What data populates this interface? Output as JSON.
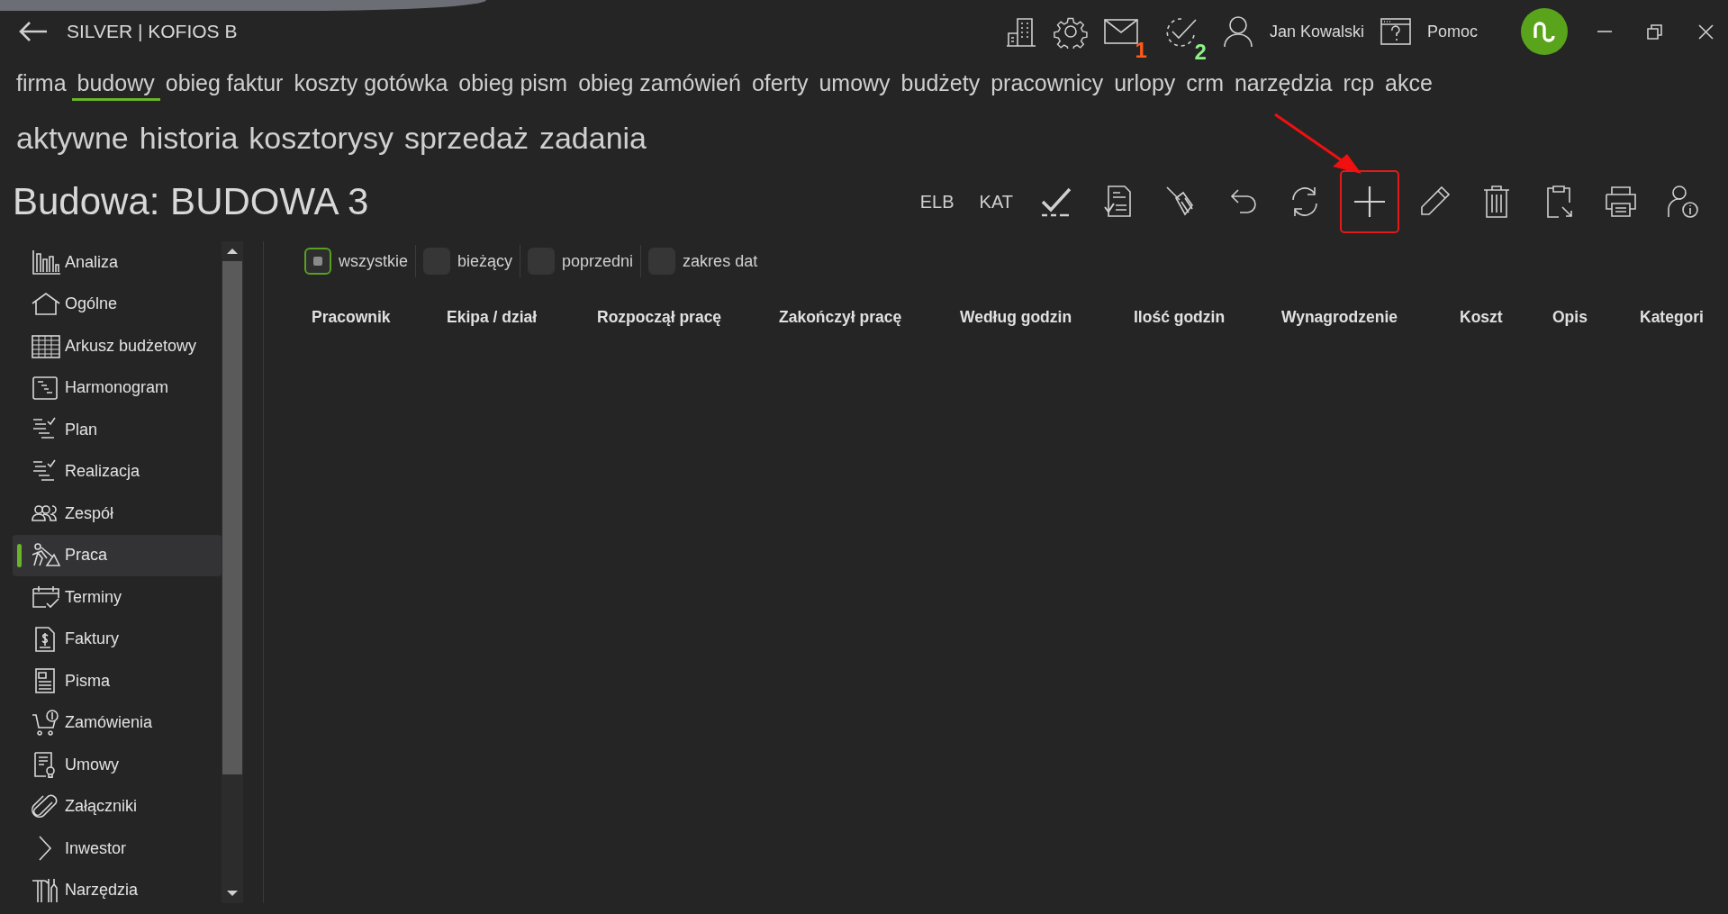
{
  "window": {
    "title": "SILVER | KOFIOS B"
  },
  "header": {
    "user": "Jan Kowalski",
    "help": "Pomoc",
    "mail_count": "1",
    "tasks_count": "2"
  },
  "main_nav": [
    {
      "label": "firma",
      "selected": false
    },
    {
      "label": "budowy",
      "selected": true
    },
    {
      "label": "obieg faktur",
      "selected": false
    },
    {
      "label": "koszty gotówka",
      "selected": false
    },
    {
      "label": "obieg pism",
      "selected": false
    },
    {
      "label": "obieg zamówień",
      "selected": false
    },
    {
      "label": "oferty",
      "selected": false
    },
    {
      "label": "umowy",
      "selected": false
    },
    {
      "label": "budżety",
      "selected": false
    },
    {
      "label": "pracownicy",
      "selected": false
    },
    {
      "label": "urlopy",
      "selected": false
    },
    {
      "label": "crm",
      "selected": false
    },
    {
      "label": "narzędzia",
      "selected": false
    },
    {
      "label": "rcp",
      "selected": false
    },
    {
      "label": "akce",
      "selected": false
    }
  ],
  "sub_nav": [
    "aktywne",
    "historia",
    "kosztorysy",
    "sprzedaż",
    "zadania"
  ],
  "page_title": "Budowa: BUDOWA 3",
  "toolbar": [
    {
      "kind": "text",
      "label": "ELB",
      "highlighted": false
    },
    {
      "kind": "text",
      "label": "KAT",
      "highlighted": false
    },
    {
      "kind": "check",
      "highlighted": false
    },
    {
      "kind": "doc",
      "highlighted": false
    },
    {
      "kind": "broom",
      "highlighted": false
    },
    {
      "kind": "undo",
      "highlighted": false
    },
    {
      "kind": "refresh",
      "highlighted": false
    },
    {
      "kind": "add",
      "highlighted": true
    },
    {
      "kind": "edit",
      "highlighted": false
    },
    {
      "kind": "delete",
      "highlighted": false
    },
    {
      "kind": "clipboard",
      "highlighted": false
    },
    {
      "kind": "print",
      "highlighted": false
    },
    {
      "kind": "userinfo",
      "highlighted": false
    }
  ],
  "sidebar": {
    "items": [
      {
        "label": "Analiza",
        "selected": false
      },
      {
        "label": "Ogólne",
        "selected": false
      },
      {
        "label": "Arkusz budżetowy",
        "selected": false
      },
      {
        "label": "Harmonogram",
        "selected": false
      },
      {
        "label": "Plan",
        "selected": false
      },
      {
        "label": "Realizacja",
        "selected": false
      },
      {
        "label": "Zespół",
        "selected": false
      },
      {
        "label": "Praca",
        "selected": true
      },
      {
        "label": "Terminy",
        "selected": false
      },
      {
        "label": "Faktury",
        "selected": false
      },
      {
        "label": "Pisma",
        "selected": false
      },
      {
        "label": "Zamówienia",
        "selected": false
      },
      {
        "label": "Umowy",
        "selected": false
      },
      {
        "label": "Załączniki",
        "selected": false
      },
      {
        "label": "Inwestor",
        "selected": false
      },
      {
        "label": "Narzędzia",
        "selected": false
      }
    ]
  },
  "filters": [
    {
      "label": "wszystkie",
      "selected": true
    },
    {
      "label": "bieżący",
      "selected": false
    },
    {
      "label": "poprzedni",
      "selected": false
    },
    {
      "label": "zakres dat",
      "selected": false
    }
  ],
  "table": {
    "columns": [
      "Pracownik",
      "Ekipa / dział",
      "Rozpoczął pracę",
      "Zakończył pracę",
      "Według godzin",
      "Ilość godzin",
      "Wynagrodzenie",
      "Koszt",
      "Opis",
      "Kategori"
    ]
  }
}
